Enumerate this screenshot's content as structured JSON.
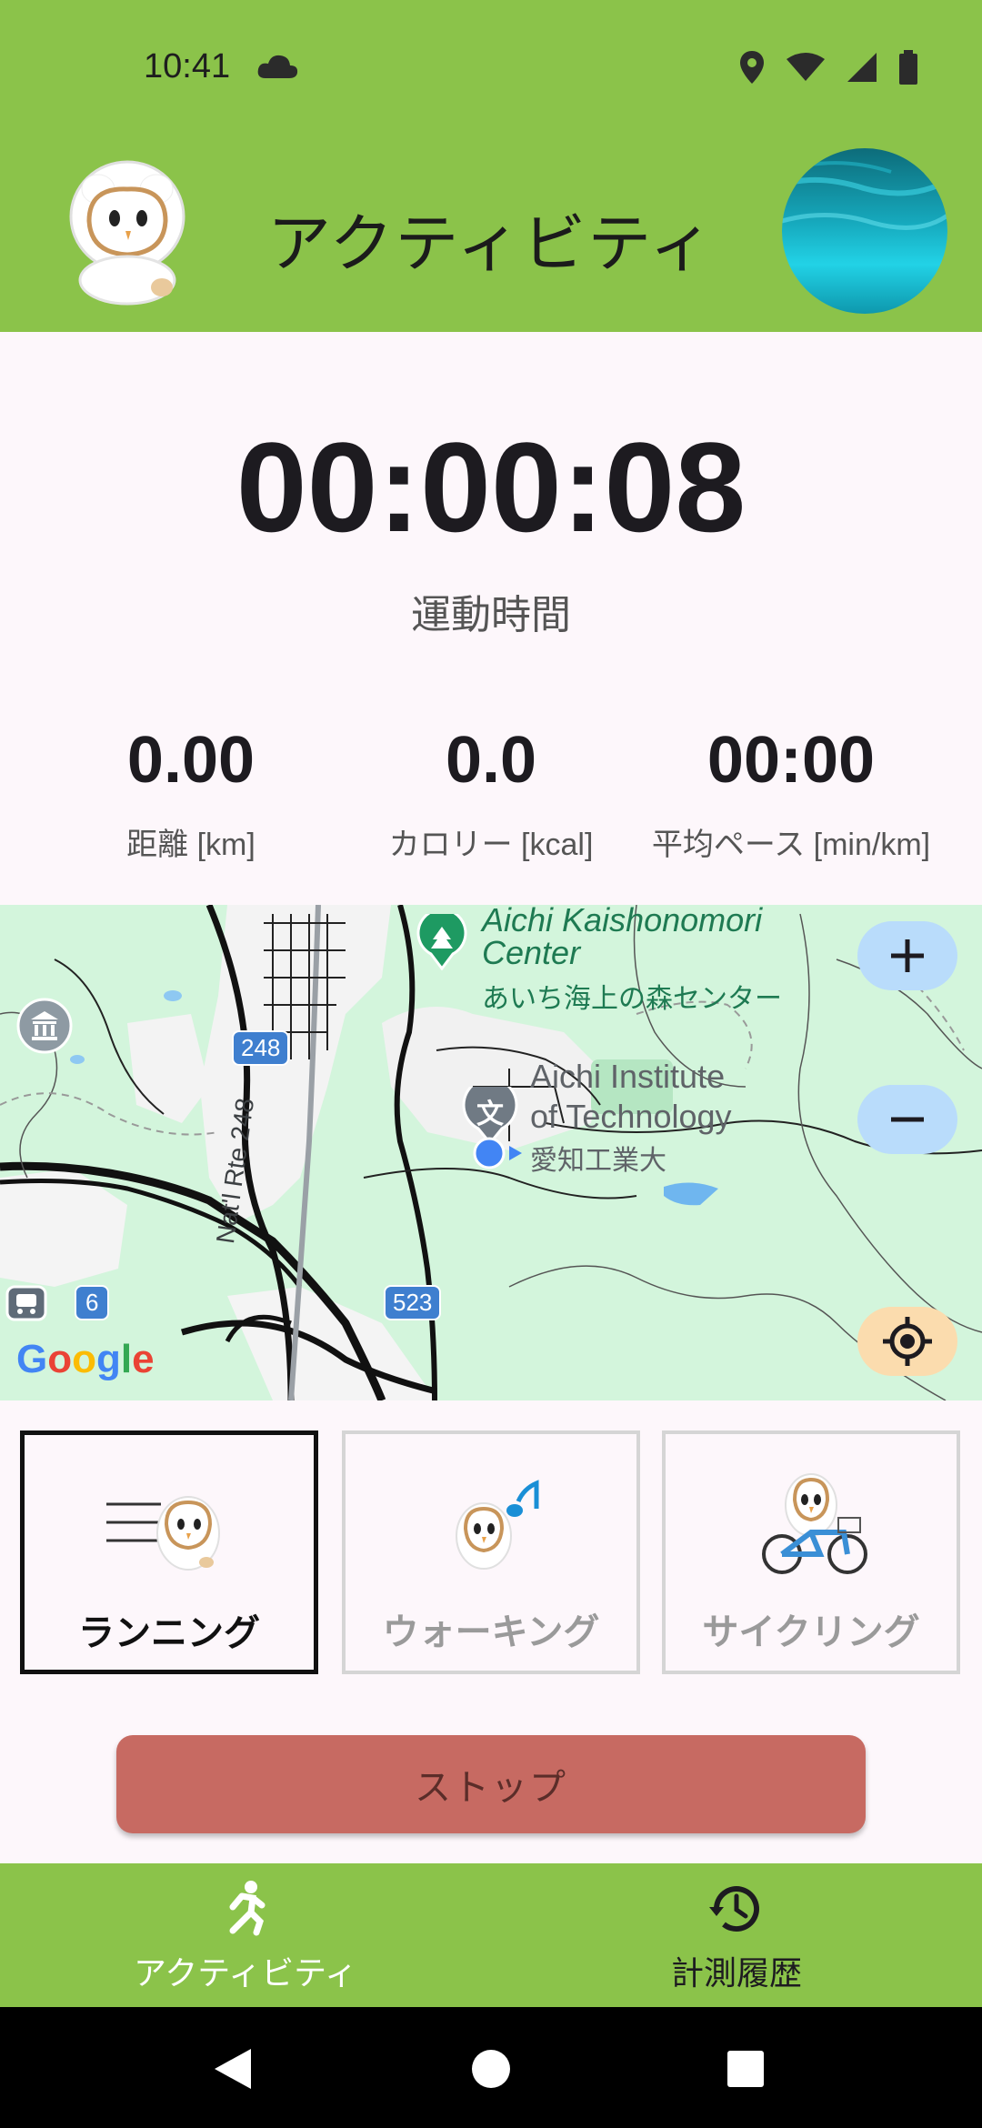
{
  "status_bar": {
    "time": "10:41",
    "icons": [
      "cloud-icon",
      "location-icon",
      "wifi-icon",
      "signal-icon",
      "battery-icon"
    ]
  },
  "header": {
    "title": "アクティビティ",
    "logo": "owl-mascot",
    "avatar": "underwater-photo"
  },
  "timer": {
    "value": "00:00:08",
    "label": "運動時間"
  },
  "stats": [
    {
      "value": "0.00",
      "label": "距離 [km]"
    },
    {
      "value": "0.0",
      "label": "カロリー [kcal]"
    },
    {
      "value": "00:00",
      "label": "平均ペース [min/km]"
    }
  ],
  "map": {
    "places": {
      "kaishonomori_en_1": "Aichi Kaishonomori",
      "kaishonomori_en_2": "Center",
      "kaishonomori_ja": "あいち海上の森センター",
      "ait_en_1": "Aichi Institute",
      "ait_en_2": "of Technology",
      "ait_ja": "愛知工業大"
    },
    "roads": {
      "r248": "248",
      "nat_rte": "Nat'l Rte 248",
      "r523": "523",
      "r6": "6"
    },
    "attribution": "Google",
    "controls": {
      "zoom_in": "+",
      "zoom_out": "−"
    }
  },
  "activities": [
    {
      "name": "ランニング",
      "selected": true
    },
    {
      "name": "ウォーキング",
      "selected": false
    },
    {
      "name": "サイクリング",
      "selected": false
    }
  ],
  "stop_button": "ストップ",
  "bottom_nav": [
    {
      "label": "アクティビティ",
      "icon": "running-icon",
      "active": true
    },
    {
      "label": "計測履歴",
      "icon": "history-icon",
      "active": false
    }
  ],
  "colors": {
    "primary": "#8bc34a",
    "stop": "#c76a62",
    "background": "#fdf7fb"
  }
}
